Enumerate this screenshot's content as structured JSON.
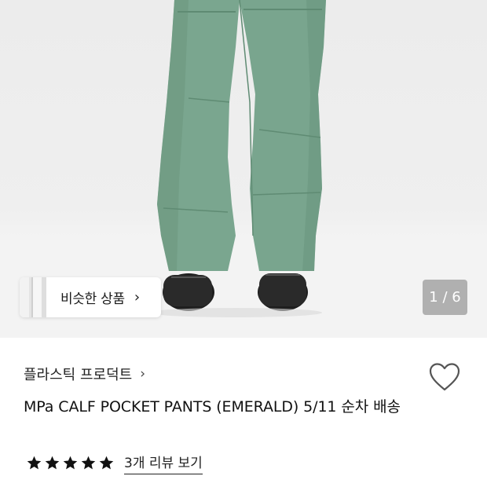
{
  "gallery": {
    "similar_label": "비슷한 상품",
    "similar_chevron": "›",
    "counter": "1 / 6"
  },
  "product": {
    "brand": "플라스틱 프로덕트",
    "brand_chevron": "›",
    "title": "MPa CALF POCKET PANTS (EMERALD) 5/11 순차 배송",
    "rating_stars": 5,
    "review_link": "3개 리뷰 보기"
  },
  "colors": {
    "pants": "#7aa68f",
    "star": "#111111",
    "counter_bg": "#7f7f7f"
  },
  "icons": {
    "heart": "heart-icon",
    "star": "star-icon",
    "chevron": "chevron-right-icon"
  }
}
